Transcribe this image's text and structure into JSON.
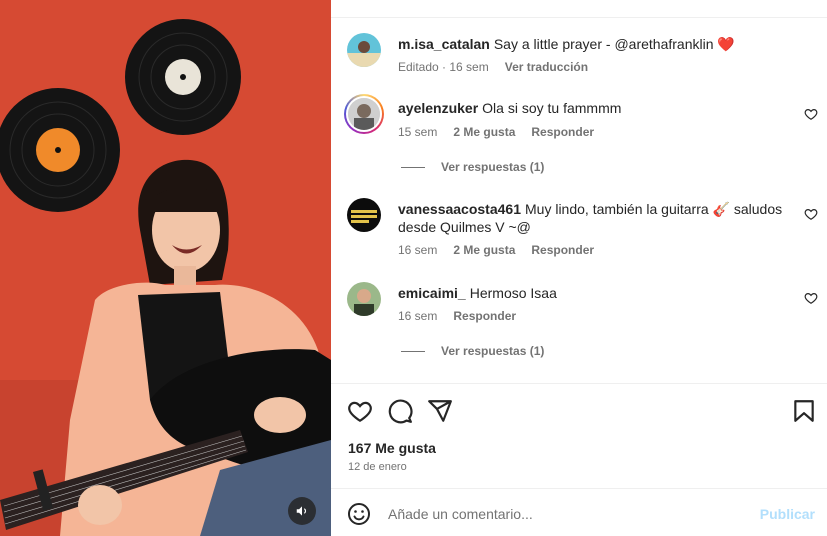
{
  "post": {
    "author": "m.isa_catalan",
    "caption": "Say a little prayer - @arethafranklin",
    "caption_emoji": "❤️",
    "edited_label": "Editado",
    "age": "16 sem",
    "translate_label": "Ver traducción"
  },
  "comments": [
    {
      "user": "ayelenzuker",
      "text": "Ola si soy tu fammmm",
      "age": "15 sem",
      "likes": "2 Me gusta",
      "reply_label": "Responder",
      "replies_label": "Ver respuestas (1)"
    },
    {
      "user": "vanessaacosta461",
      "text": "Muy lindo, también la guitarra 🎸 saludos desde Quilmes V ~@",
      "age": "16 sem",
      "likes": "2 Me gusta",
      "reply_label": "Responder"
    },
    {
      "user": "emicaimi_",
      "text": "Hermoso Isaa",
      "age": "16 sem",
      "reply_label": "Responder",
      "replies_label": "Ver respuestas (1)"
    }
  ],
  "engagement": {
    "likes": "167 Me gusta",
    "date": "12 de enero"
  },
  "composer": {
    "placeholder": "Añade un comentario...",
    "publish_label": "Publicar"
  },
  "icons": {
    "like": "heart-outline-icon",
    "comment": "comment-bubble-icon",
    "share": "paper-plane-icon",
    "save": "bookmark-icon",
    "emoji": "smiley-icon",
    "sound": "speaker-icon"
  },
  "colors": {
    "wall": "#d64a33",
    "caption_heart": "#ed4956",
    "publish_disabled": "#b2dffc",
    "muted_text": "#737373"
  }
}
